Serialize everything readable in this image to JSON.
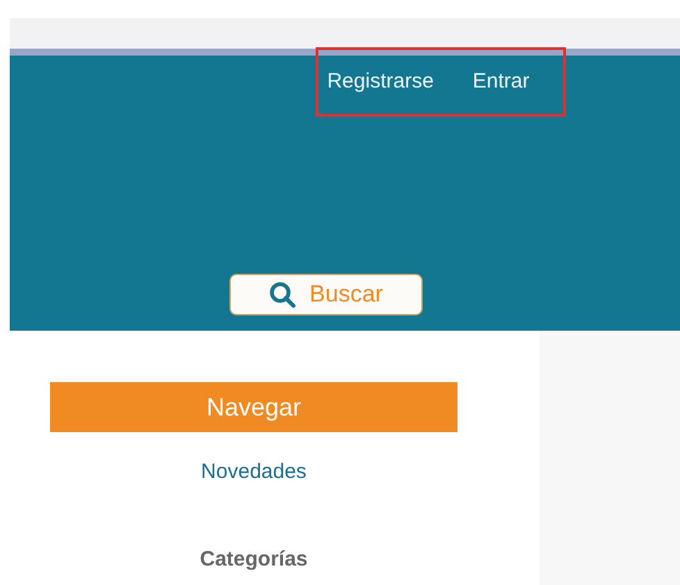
{
  "header": {
    "links": [
      {
        "label": "Registrarse"
      },
      {
        "label": "Entrar"
      }
    ],
    "highlighted": true,
    "search_button": {
      "label": "Buscar"
    }
  },
  "sidebar": {
    "heading": "Navegar",
    "items": [
      {
        "kind": "link",
        "label": "Novedades"
      },
      {
        "kind": "heading",
        "label": "Categorías"
      }
    ]
  }
}
